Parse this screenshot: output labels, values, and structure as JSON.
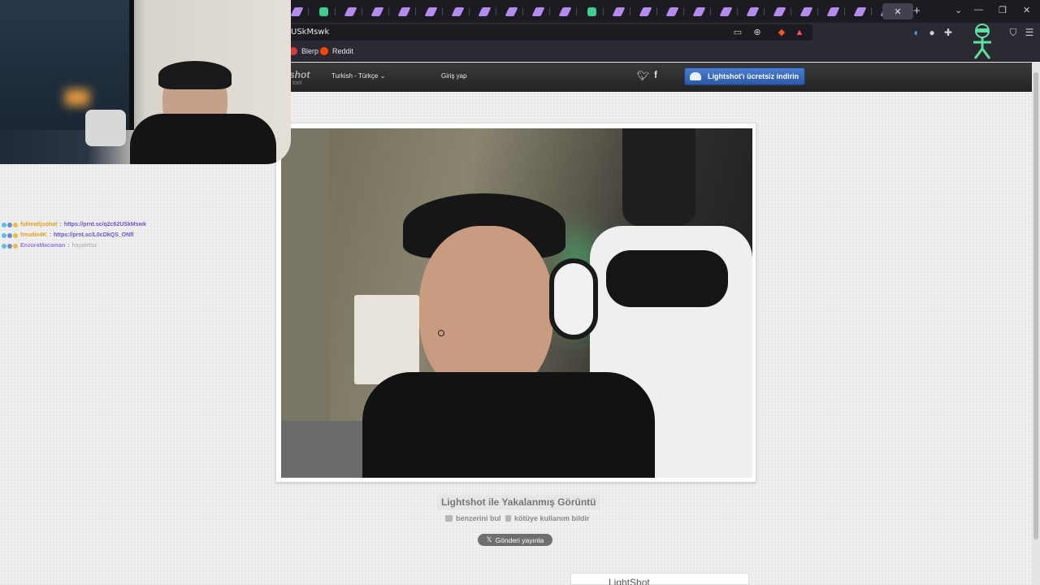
{
  "browser": {
    "url": "USkMswk",
    "bookmarks": [
      "Blerp",
      "Reddit"
    ]
  },
  "site": {
    "logo": "shot",
    "logo_sub": "tool",
    "language": "Turkish - Türkçe",
    "login": "Giriş yap",
    "download_button": "Lightshot'ı ücretsiz indirin",
    "capture_title": "Lightshot ile Yakalanmış Görüntü",
    "find_similar": "benzerini bul",
    "report_abuse": "kötüye kullanım bildir",
    "post_button": "Gönderi yayınla",
    "bottom_logo": "LightShot"
  },
  "chat": [
    {
      "user": "fulimatijsohat",
      "message": "https://prnt.sc/q2c62USkMswk",
      "color": "#e8a020"
    },
    {
      "user": "freudin4K",
      "message": "https://prnt.sc/L0cDkQS_ONfl",
      "color": "#e8a020"
    },
    {
      "user": "EnzoraMacaman",
      "message": "hayaletsiz",
      "color": "#9a7ae0"
    }
  ],
  "colors": {
    "browser_bg": "#1c1b22",
    "toolbar_bg": "#2b2a33",
    "header_bg": "#2b2b2b",
    "download_blue": "#3a6cc0",
    "page_bg": "#efefef"
  },
  "icons": [
    "tab-favicon",
    "close-icon",
    "plus-icon",
    "chevron-down-icon",
    "minimize-icon",
    "maximize-icon",
    "window-close-icon",
    "reader-icon",
    "zoom-icon",
    "brave-shield-icon",
    "extension-icon",
    "menu-icon",
    "twitter-icon",
    "facebook-icon",
    "cloud-icon",
    "camera-icon",
    "flag-icon"
  ]
}
